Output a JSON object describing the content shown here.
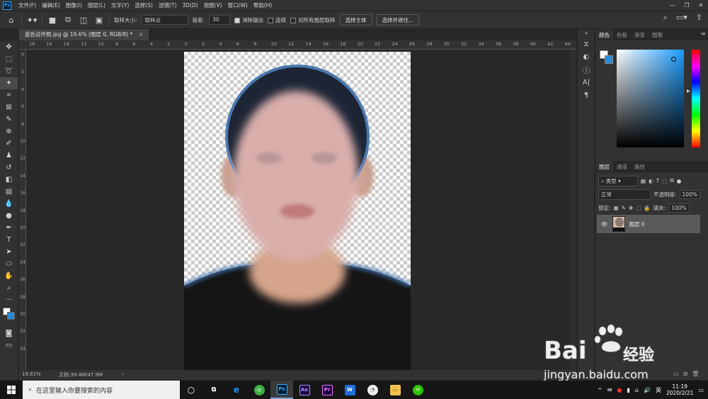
{
  "menubar": {
    "app_icon": "Ps",
    "items": [
      "文件(F)",
      "编辑(E)",
      "图像(I)",
      "图层(L)",
      "文字(Y)",
      "选择(S)",
      "滤镜(T)",
      "3D(D)",
      "视图(V)",
      "窗口(W)",
      "帮助(H)"
    ],
    "window_controls": [
      "—",
      "❐",
      "✕"
    ]
  },
  "options": {
    "sample_size_label": "取样大小:",
    "sample_size_value": "取样点",
    "tolerance_label": "容差:",
    "tolerance_value": "30",
    "antialias_label": "消除锯齿",
    "antialias_checked": true,
    "contiguous_label": "连续",
    "contiguous_checked": false,
    "all_layers_label": "对所有图层取样",
    "all_layers_checked": false,
    "select_subject_label": "选择主体",
    "select_mask_label": "选择并遮住..."
  },
  "document": {
    "tab_title": "蓝色证件照.jpg @ 19.6% (图层 0, RGB/8) *",
    "zoom": "19.61%",
    "doc_size": "文档:39.4M/47.9M"
  },
  "rulers": {
    "horizontal": [
      "18",
      "16",
      "14",
      "12",
      "10",
      "8",
      "6",
      "4",
      "2",
      "0",
      "2",
      "4",
      "6",
      "8",
      "10",
      "12",
      "14",
      "16",
      "18",
      "20",
      "22",
      "24",
      "26",
      "28",
      "30",
      "32",
      "34",
      "36",
      "38",
      "40",
      "42",
      "44"
    ],
    "vertical": [
      "0",
      "2",
      "4",
      "6",
      "8",
      "1 0",
      "1 2",
      "1 4",
      "1 6",
      "1 8",
      "2 0",
      "2 2",
      "2 4",
      "2 6",
      "2 8",
      "3 0",
      "3 2",
      "3 4"
    ]
  },
  "panels": {
    "color_tabs": [
      "颜色",
      "色板",
      "渐变",
      "图案"
    ],
    "layers_tabs": [
      "图层",
      "通道",
      "路径"
    ],
    "filter_kind": "类型",
    "blend_mode": "正常",
    "opacity_label": "不透明度:",
    "opacity_value": "100%",
    "lock_label": "锁定:",
    "fill_label": "填充:",
    "fill_value": "100%",
    "layer_name": "图层 0"
  },
  "colors": {
    "foreground": "#ffffff",
    "background": "#2a8ad8"
  },
  "taskbar": {
    "search_placeholder": "在这里输入你要搜索的内容",
    "apps": [
      "cortana",
      "task-view",
      "edge",
      "360-browser",
      "photoshop",
      "after-effects",
      "premiere",
      "wps",
      "unknown-app",
      "file-explorer",
      "wechat"
    ],
    "ime": "英",
    "time": "11:19",
    "date": "2020/2/21"
  },
  "watermark": {
    "brand": "Bai",
    "brand_tail": "经验",
    "url": "jingyan.baidu.com"
  }
}
